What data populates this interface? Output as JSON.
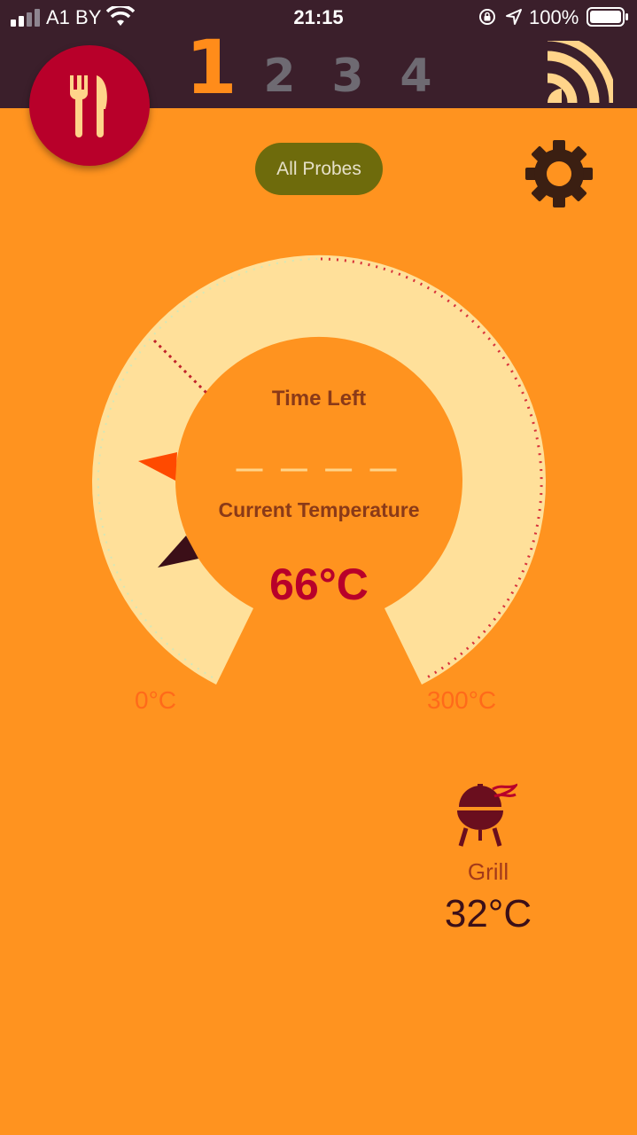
{
  "status_bar": {
    "carrier": "A1 BY",
    "time": "21:15",
    "battery": "100%"
  },
  "header": {
    "probe_tabs": [
      {
        "label": "1",
        "active": true
      },
      {
        "label": "2",
        "active": false
      },
      {
        "label": "3",
        "active": false
      },
      {
        "label": "4",
        "active": false
      }
    ],
    "icons": {
      "logo": "fork-knife-icon",
      "connection": "signal-strength-icon"
    }
  },
  "controls": {
    "all_probes_label": "All Probes",
    "settings_icon": "gear-icon"
  },
  "gauge": {
    "time_left_label": "Time Left",
    "time_left_value": "— — — —",
    "current_temp_label": "Current Temperature",
    "current_temp_value": "66°C",
    "range_min": "0°C",
    "range_max": "300°C",
    "current_temp_c": 66,
    "min_c": 0,
    "max_c": 300
  },
  "grill": {
    "label": "Grill",
    "value": "32°C",
    "icon": "grill-icon"
  },
  "colors": {
    "background": "#FF931F",
    "header": "#3B1F2B",
    "accent": "#B8002A",
    "gauge_ring": "#FFE09A",
    "all_probes_button": "#6E6B0C"
  }
}
